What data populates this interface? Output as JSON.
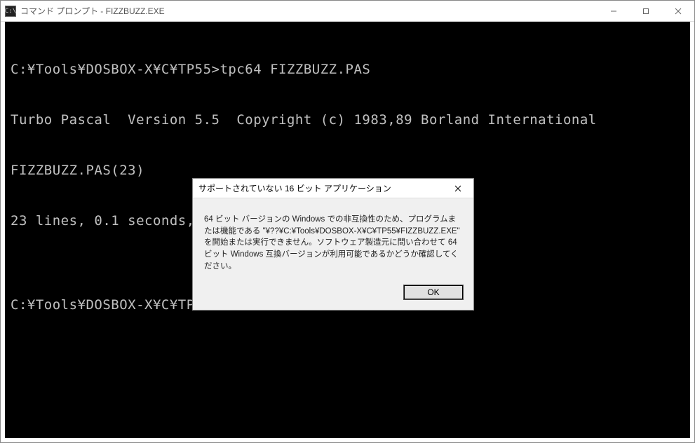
{
  "window": {
    "title": "コマンド プロンプト - FIZZBUZZ.EXE",
    "icon_glyph": "C:\\"
  },
  "console": {
    "lines": [
      "C:¥Tools¥DOSBOX-X¥C¥TP55>tpc64 FIZZBUZZ.PAS",
      "Turbo Pascal  Version 5.5  Copyright (c) 1983,89 Borland International",
      "FIZZBUZZ.PAS(23)",
      "23 lines, 0.1 seconds, 2336 bytes code, 648 bytes data.",
      "",
      "C:¥Tools¥DOSBOX-X¥C¥TP55>FIZZBUZZ.EXE"
    ]
  },
  "dialog": {
    "title": "サポートされていない 16 ビット アプリケーション",
    "body": "64 ビット バージョンの Windows での非互換性のため、プログラムまたは機能である \"¥??¥C:¥Tools¥DOSBOX-X¥C¥TP55¥FIZZBUZZ.EXE\" を開始または実行できません。ソフトウェア製造元に問い合わせて 64 ビット Windows 互換バージョンが利用可能であるかどうか確認してください。",
    "ok_label": "OK"
  }
}
